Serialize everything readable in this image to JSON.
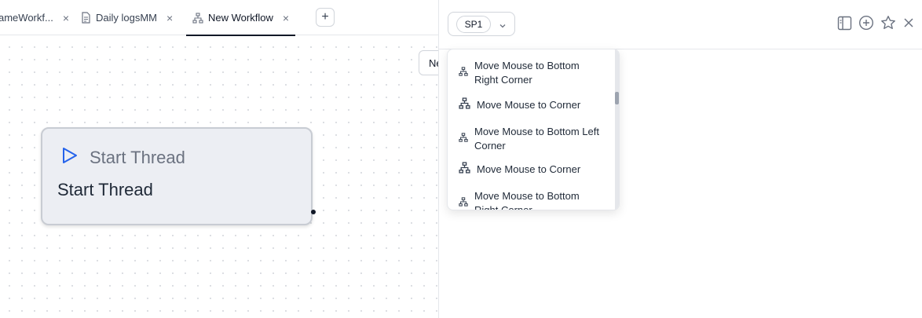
{
  "tabs": [
    {
      "label": "ameWorkf...",
      "icon": "workflow-icon",
      "active": false
    },
    {
      "label": "Daily logsMM",
      "icon": "document-icon",
      "active": false
    },
    {
      "label": "New Workflow",
      "icon": "workflow-icon",
      "active": true
    }
  ],
  "tab_close_glyph": "×",
  "add_tab_glyph": "+",
  "canvas": {
    "chip_label": "Ne",
    "node": {
      "title": "Start Thread",
      "body": "Start Thread",
      "icon": "play-icon"
    }
  },
  "panel": {
    "agent_label": "SP1",
    "header_icons": [
      "sidebar-toggle-icon",
      "add-circle-icon",
      "star-icon",
      "close-icon"
    ],
    "dropdown_items": [
      "Move Mouse to Bottom Right Corner",
      "Move Mouse to Corner",
      "Move Mouse to Bottom Left Corner",
      "Move Mouse to Corner",
      "Move Mouse to Bottom Right Corner"
    ]
  },
  "colors": {
    "accent": "#2563eb",
    "node_bg": "#eceef3"
  }
}
